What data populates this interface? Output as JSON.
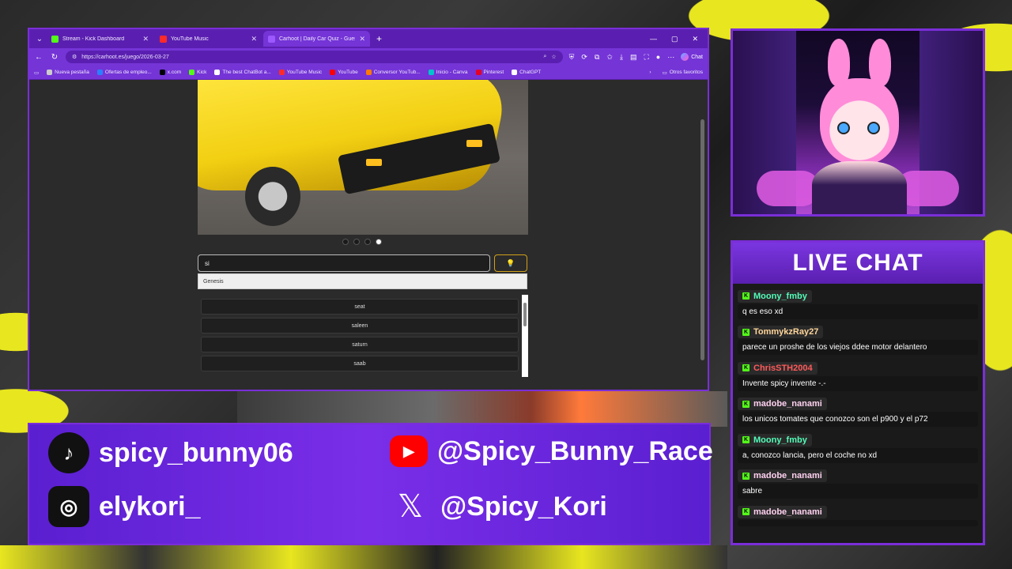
{
  "browser": {
    "tabs": [
      {
        "label": "Stream - Kick Dashboard",
        "color": "#53fc18",
        "active": false
      },
      {
        "label": "YouTube Music",
        "color": "#ff2a2a",
        "active": false
      },
      {
        "label": "Carhoot | Daily Car Quiz - Guess t",
        "color": "#9b59ff",
        "active": true
      }
    ],
    "url": "https://carhoot.es/juego/2026-03-27",
    "chat_label": "Chat",
    "bookmarks": [
      {
        "label": "Nueva pestaña",
        "color": "#cccccc"
      },
      {
        "label": "Ofertas de empleo...",
        "color": "#2a7fff"
      },
      {
        "label": "x.com",
        "color": "#000000"
      },
      {
        "label": "Kick",
        "color": "#53fc18"
      },
      {
        "label": "The best ChatBot a...",
        "color": "#ffffff"
      },
      {
        "label": "YouTube Music",
        "color": "#ff2a2a"
      },
      {
        "label": "YouTube",
        "color": "#ff0000"
      },
      {
        "label": "Conversor YouTub...",
        "color": "#ff7a00"
      },
      {
        "label": "Inicio - Canva",
        "color": "#00c4cc"
      },
      {
        "label": "Pinterest",
        "color": "#e60023"
      },
      {
        "label": "ChatGPT",
        "color": "#ffffff"
      }
    ],
    "other_bookmarks": "Otros favoritos"
  },
  "game": {
    "guess_value": "si",
    "hint_icon": "lightbulb-icon",
    "suggestion": "Genesis",
    "brands": [
      "seat",
      "saleen",
      "saturn",
      "saab"
    ],
    "carousel_total": 4,
    "carousel_active": 4
  },
  "chat": {
    "title": "LIVE CHAT",
    "messages": [
      {
        "user": "Moony_fmby",
        "color": "#53fcb8",
        "text": "q es eso xd"
      },
      {
        "user": "TommykzRay27",
        "color": "#ffd59a",
        "text": "parece un proshe de los viejos ddee motor delantero"
      },
      {
        "user": "ChrisSTH2004",
        "color": "#ff5a5a",
        "text": "Invente spicy invente -.-"
      },
      {
        "user": "madobe_nanami",
        "color": "#ffd1f0",
        "text": "los unicos tomates que conozco son el p900 y el p72"
      },
      {
        "user": "Moony_fmby",
        "color": "#53fcb8",
        "text": "a, conozco lancia, pero el coche no xd"
      },
      {
        "user": "madobe_nanami",
        "color": "#ffd1f0",
        "text": "sabre"
      },
      {
        "user": "madobe_nanami",
        "color": "#ffd1f0",
        "text": ""
      }
    ]
  },
  "socials": {
    "tiktok": "spicy_bunny06",
    "youtube": "@Spicy_Bunny_Race",
    "instagram": "elykori_",
    "x": "@Spicy_Kori"
  },
  "colors": {
    "accent": "#7a2ed8",
    "kick_green": "#53fc18",
    "background_yellow": "#e8e61f"
  }
}
